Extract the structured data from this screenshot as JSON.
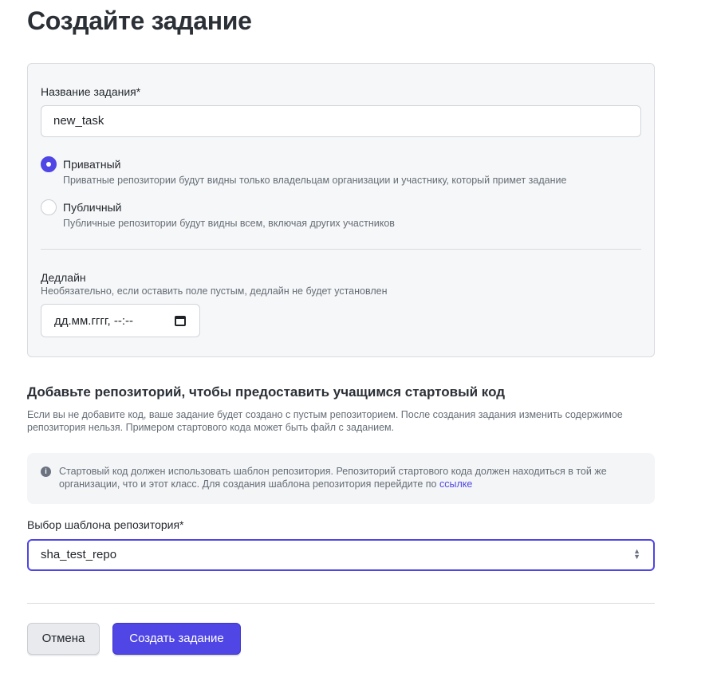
{
  "page_title": "Создайте задание",
  "task_form": {
    "name_label": "Название задания*",
    "name_value": "new_task",
    "visibility": {
      "options": [
        {
          "title": "Приватный",
          "description": "Приватные репозитории будут видны только владельцам организации и участнику, который примет задание",
          "selected": true
        },
        {
          "title": "Публичный",
          "description": "Публичные репозитории будут видны всем, включая других участников",
          "selected": false
        }
      ]
    },
    "deadline": {
      "label": "Дедлайн",
      "hint": "Необязательно, если оставить поле пустым, дедлайн не будет установлен",
      "placeholder": "дд.мм.гггг, --:--"
    }
  },
  "repo_section": {
    "title": "Добавьте репозиторий, чтобы предоставить учащимся стартовый код",
    "description": "Если вы не добавите код, ваше задание будет создано с пустым репозиторием. После создания задания изменить содержимое репозитория нельзя. Примером стартового кода может быть файл с заданием.",
    "notice_text": "Стартовый код должен использовать шаблон репозитория. Репозиторий стартового кода должен находиться в той же организации, что и этот класс. Для создания шаблона репозитория перейдите по ",
    "notice_link": "ссылке",
    "select_label": "Выбор шаблона репозитория*",
    "select_value": "sha_test_repo"
  },
  "buttons": {
    "cancel": "Отмена",
    "create": "Создать задание"
  },
  "colors": {
    "accent": "#4f46e5"
  }
}
